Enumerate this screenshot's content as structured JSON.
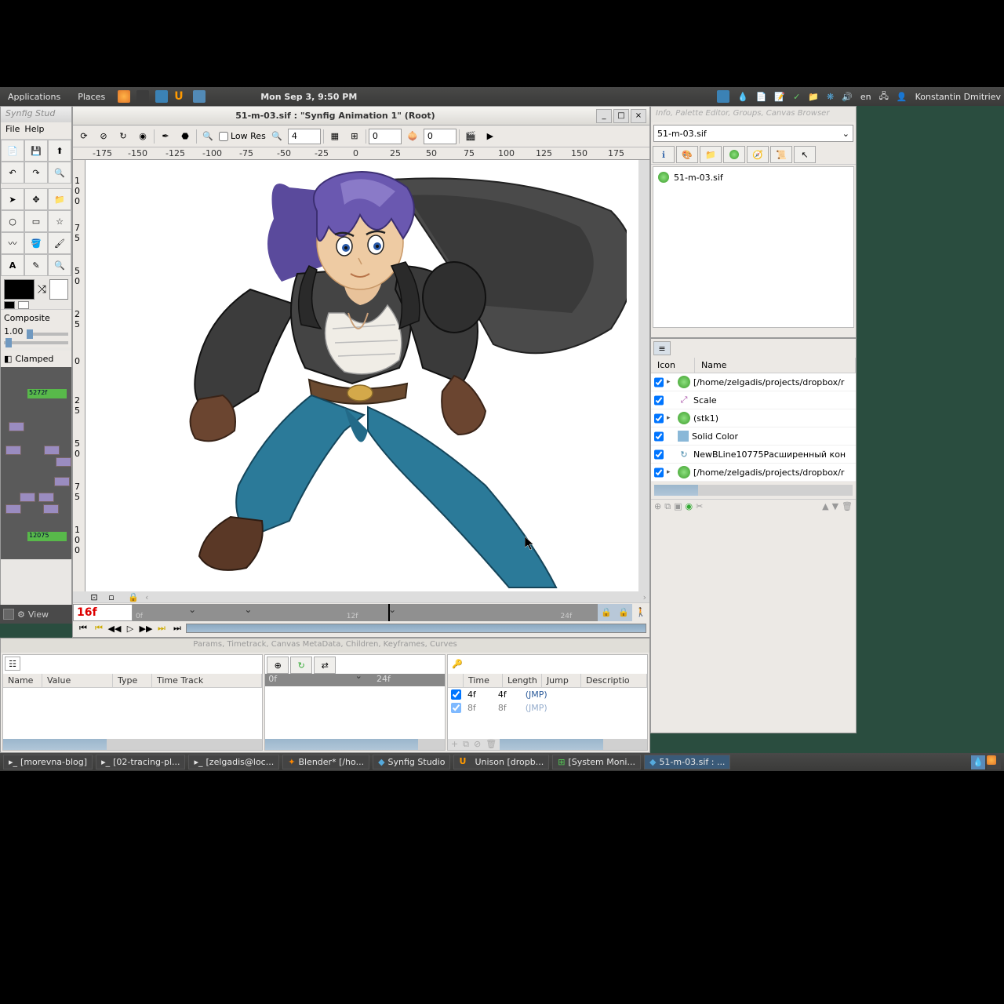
{
  "gnome": {
    "applications": "Applications",
    "places": "Places",
    "clock": "Mon Sep 3,  9:50 PM",
    "lang": "en",
    "user": "Konstantin Dmitriev"
  },
  "toolbox": {
    "title": "Synfig Stud",
    "file": "File",
    "help": "Help",
    "composite": "Composite",
    "opacity": "1.00",
    "clamped": "Clamped"
  },
  "timeline_mini": {
    "marker1": "5272f",
    "marker2": "12075"
  },
  "main": {
    "title": "51-m-03.sif : \"Synfig Animation 1\" (Root)",
    "lowres": "Low Res",
    "quality": "4",
    "coord_x": "0",
    "coord_y": "0",
    "frame": "16f",
    "track_labels": [
      "0f",
      "12f",
      "24f"
    ]
  },
  "view_label": "View",
  "ruler_h": [
    "-175",
    "-150",
    "-125",
    "-100",
    "-75",
    "-50",
    "-25",
    "0",
    "25",
    "50",
    "75",
    "100",
    "125",
    "150",
    "175"
  ],
  "ruler_v": [
    "1 0 0",
    "7 5",
    "5 0",
    "2 5",
    "0",
    "2 5",
    "5 0",
    "7 5",
    "1 0 0"
  ],
  "panels": {
    "tabs": "Params, Timetrack, Canvas MetaData, Children, Keyframes, Curves",
    "table1": {
      "name": "Name",
      "value": "Value",
      "type": "Type",
      "track": "Time Track"
    },
    "tl_labels": [
      "0f",
      "24f"
    ],
    "kf_hdr": {
      "time": "Time",
      "length": "Length",
      "jump": "Jump",
      "desc": "Descriptio"
    },
    "keyframes": [
      {
        "time": "4f",
        "length": "4f",
        "jump": "(JMP)"
      },
      {
        "time": "8f",
        "length": "8f",
        "jump": "(JMP)"
      }
    ]
  },
  "right1": {
    "title": "Info, Palette Editor, Groups, Canvas Browser",
    "combo": "51-m-03.sif",
    "item": "51-m-03.sif"
  },
  "layers": {
    "hdr_icon": "Icon",
    "hdr_name": "Name",
    "rows": [
      {
        "name": "[/home/zelgadis/projects/dropbox/r",
        "expand": true,
        "icon": "ball"
      },
      {
        "name": "Scale",
        "expand": false,
        "icon": "scale"
      },
      {
        "name": "(stk1)",
        "expand": true,
        "icon": "ball"
      },
      {
        "name": "Solid Color",
        "expand": false,
        "icon": "solid"
      },
      {
        "name": "NewBLine10775Расширенный кон",
        "expand": false,
        "icon": "bline"
      },
      {
        "name": "[/home/zelgadis/projects/dropbox/r",
        "expand": true,
        "icon": "ball"
      }
    ]
  },
  "tasks": [
    "[morevna-blog]",
    "[02-tracing-pl...",
    "[zelgadis@loc...",
    "Blender* [/ho...",
    "Synfig Studio",
    "Unison [dropb...",
    "[System Moni...",
    "51-m-03.sif : ..."
  ]
}
